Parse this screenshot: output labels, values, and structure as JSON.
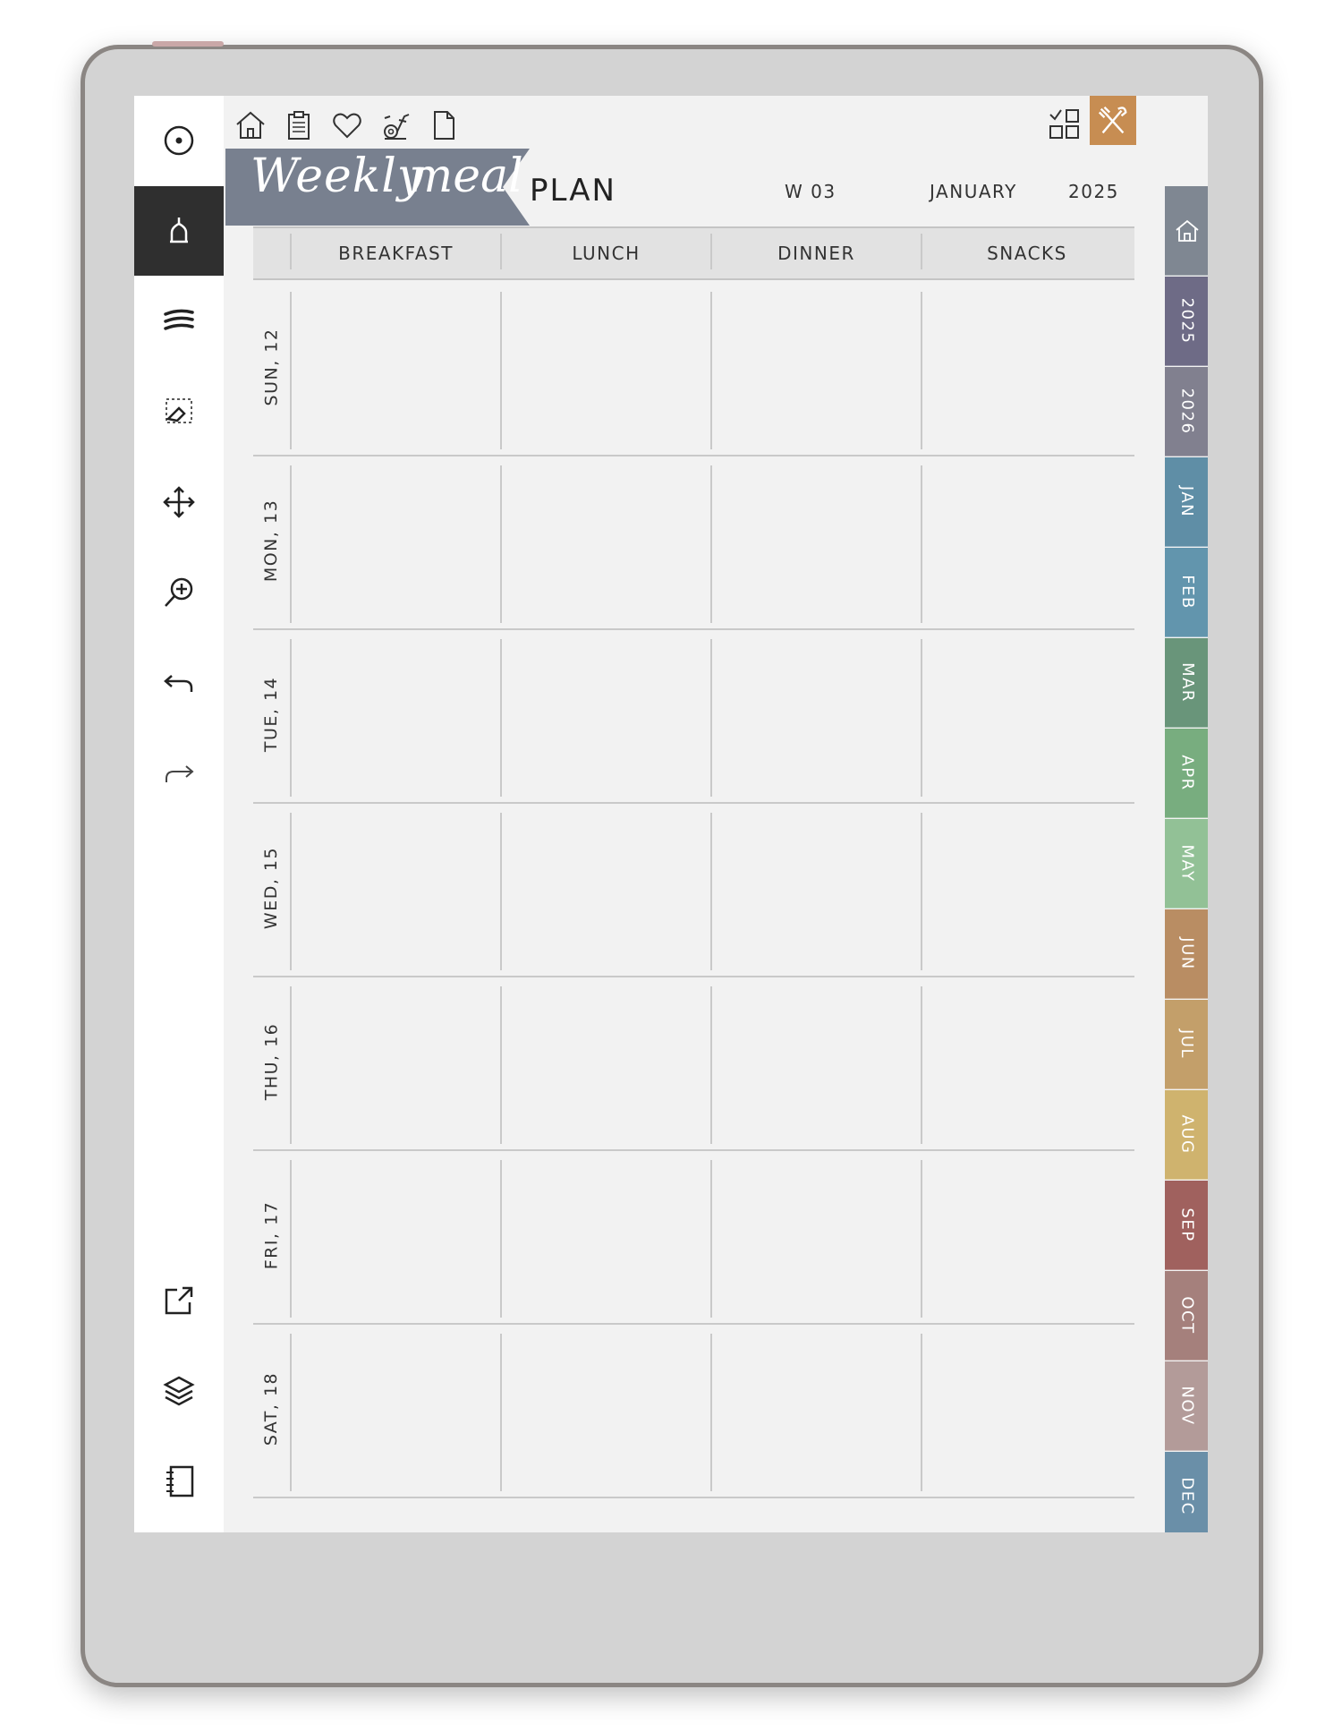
{
  "toolbar": {
    "tools": [
      {
        "name": "menu-circle-icon"
      },
      {
        "name": "pen-tool-icon",
        "active": true
      },
      {
        "name": "highlighter-icon"
      },
      {
        "name": "eraser-selection-icon"
      },
      {
        "name": "move-icon"
      },
      {
        "name": "zoom-icon"
      },
      {
        "name": "undo-icon"
      },
      {
        "name": "redo-icon"
      },
      {
        "name": "export-icon"
      },
      {
        "name": "layers-icon"
      },
      {
        "name": "notebook-icon"
      }
    ]
  },
  "top_icons": [
    "home-icon",
    "clipboard-icon",
    "heart-icon",
    "exercise-bike-icon",
    "page-icon"
  ],
  "header": {
    "title_script_1": "Weekly",
    "title_script_2": "meal",
    "title_plain": "PLAN",
    "week": "W 03",
    "month": "JANUARY",
    "year": "2025"
  },
  "columns": [
    "BREAKFAST",
    "LUNCH",
    "DINNER",
    "SNACKS"
  ],
  "days": [
    "SUN, 12",
    "MON, 13",
    "TUE, 14",
    "WED, 15",
    "THU, 16",
    "FRI, 17",
    "SAT, 18"
  ],
  "side_tabs": [
    {
      "label": "home",
      "color": "#7f8792"
    },
    {
      "label": "2025",
      "color": "#6e6b86"
    },
    {
      "label": "2026",
      "color": "#81808f"
    },
    {
      "label": "JAN",
      "color": "#5f8ea6"
    },
    {
      "label": "FEB",
      "color": "#6295ad"
    },
    {
      "label": "MAR",
      "color": "#69957a"
    },
    {
      "label": "APR",
      "color": "#78ad7f"
    },
    {
      "label": "MAY",
      "color": "#92c196"
    },
    {
      "label": "JUN",
      "color": "#b98d63"
    },
    {
      "label": "JUL",
      "color": "#c39f6a"
    },
    {
      "label": "AUG",
      "color": "#cfb36e"
    },
    {
      "label": "SEP",
      "color": "#a0615e"
    },
    {
      "label": "OCT",
      "color": "#a5807c"
    },
    {
      "label": "NOV",
      "color": "#b39b99"
    },
    {
      "label": "DEC",
      "color": "#6a8fa8"
    }
  ],
  "colors": {
    "banner": "#78808f",
    "accent_meal_button": "#c78d52",
    "active_tool": "#2f2f2f"
  }
}
